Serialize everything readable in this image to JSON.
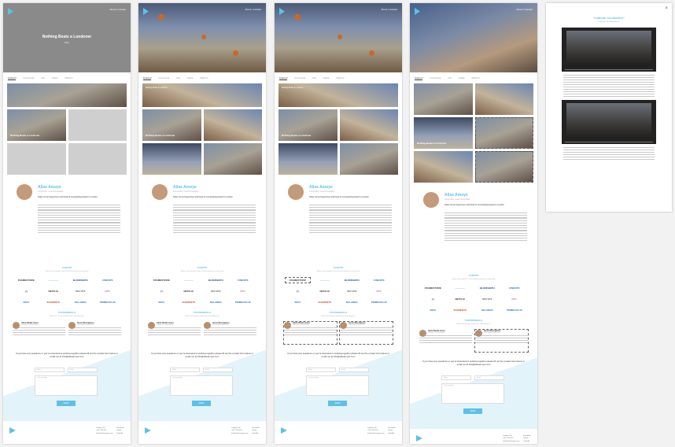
{
  "hero": {
    "nav": "About | Contact",
    "title": "Nothing Beats a Londoner",
    "sub": "Nike"
  },
  "tabs": [
    "Featured",
    "Commercial",
    "Film",
    "Digital",
    "Stills/Tvc"
  ],
  "tiles": {
    "kicker": "Nothing Beats a Londoner",
    "caption": "Nothing Beats a Londoner"
  },
  "about": {
    "name": "Alise Amoye",
    "role": "Compositor / Lead Compositor",
    "lead": "Nuke Comp Supervisor and head of compositing based in London"
  },
  "clients": {
    "title": "CLIENTS",
    "sub": "Some of the people I have had the pleasure to work with",
    "logos": [
      {
        "label": "FRAMESTORE",
        "color": "#333333"
      },
      {
        "label": "~~~~~~~",
        "color": "#2c9ad6"
      },
      {
        "label": "BLOODBATH",
        "color": "#1f3f8a"
      },
      {
        "label": "CINESITE",
        "color": "#2c72c9"
      },
      {
        "label": "(•)",
        "color": "#2e4f87"
      },
      {
        "label": "NETFLIX",
        "color": "#333333"
      },
      {
        "label": "IOO VFX",
        "color": "#555555"
      },
      {
        "label": "MPC",
        "color": "#d67ab8"
      },
      {
        "label": "IMAX",
        "color": "#2c72c9"
      },
      {
        "label": "ELEMENTS",
        "color": "#c9472c"
      },
      {
        "label": "McLAREN",
        "color": "#2c72c9"
      },
      {
        "label": "PRIMEFOCUS",
        "color": "#2c72c9"
      }
    ]
  },
  "testimonials": {
    "title": "TESTIMONIALS",
    "sub": "A few nice things people have said about me",
    "items": [
      {
        "name": "Alicia Bambi Jones",
        "role": "Producer at Post House"
      },
      {
        "name": "Oscar Moongaloos",
        "role": "VFX Supervisor at MPC"
      }
    ]
  },
  "contact": {
    "question": "If you have any questions or you're interested in working together please fill out the contact form below or email me at info@aliseamoye.com",
    "name_placeholder": "Name",
    "email_placeholder": "Email",
    "message_placeholder": "Your message",
    "send": "SEND"
  },
  "footer": {
    "col1": [
      "London, UK",
      "+44 7774 473",
      "info@aliseamoye.com"
    ],
    "col2": [
      "Facebook",
      "Twitter",
      "LinkedIn"
    ]
  },
  "modal": {
    "title": "\"COMPARE THE MEERKAT\"",
    "sub": "Compare the Market Advert"
  },
  "colors": {
    "accent": "#5cc1e8"
  }
}
